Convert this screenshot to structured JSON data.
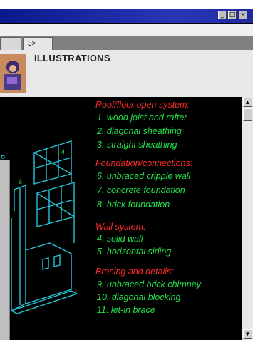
{
  "window": {
    "minimize_glyph": "_",
    "maximize_glyph": "□",
    "close_glyph": "×"
  },
  "tabs": [
    {
      "label": ""
    },
    {
      "label": "3>"
    }
  ],
  "header": {
    "title": "ILLUSTRATIONS"
  },
  "legend": {
    "sections": [
      {
        "heading": "Roof/floor open system:",
        "items": [
          "1. wood joist and rafter",
          "2. diagonal sheathing",
          "3. straight sheathing"
        ]
      },
      {
        "heading": "Foundation/connections:",
        "items": [
          "6. unbraced cripple wall",
          "7. concrete foundation",
          "8. brick foundation"
        ]
      },
      {
        "heading": "Wall system:",
        "items": [
          "4. solid wall",
          "5. horizontal siding"
        ]
      },
      {
        "heading": "Bracing and details:",
        "items": [
          "9. unbraced brick chimney",
          "10. diagonal blocking",
          "11. let-in brace"
        ]
      }
    ]
  },
  "diagram": {
    "label_a": "4",
    "label_b": "6"
  },
  "scrollbar": {
    "up_glyph": "▲",
    "down_glyph": "▼"
  },
  "colors": {
    "heading": "#ff2a2a",
    "item": "#22e04a",
    "drawing": "#26c6d6",
    "titlebar": "#0a1a8a"
  }
}
